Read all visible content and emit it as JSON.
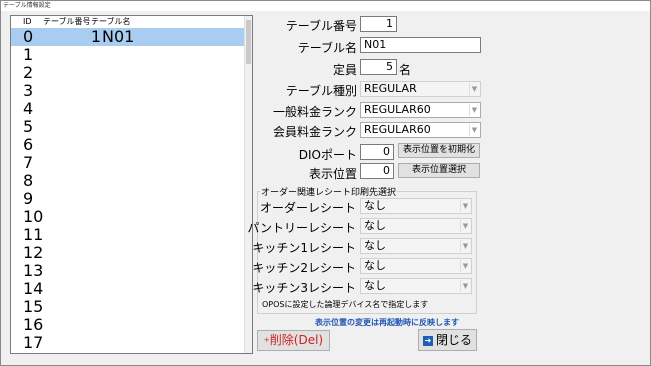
{
  "window": {
    "title": "テーブル情報設定"
  },
  "list": {
    "headers": {
      "id": "ID",
      "number": "テーブル番号",
      "name": "テーブル名"
    },
    "rows": [
      {
        "id": "0",
        "number": "1",
        "name": "N01"
      },
      {
        "id": "1",
        "number": "",
        "name": ""
      },
      {
        "id": "2",
        "number": "",
        "name": ""
      },
      {
        "id": "3",
        "number": "",
        "name": ""
      },
      {
        "id": "4",
        "number": "",
        "name": ""
      },
      {
        "id": "5",
        "number": "",
        "name": ""
      },
      {
        "id": "6",
        "number": "",
        "name": ""
      },
      {
        "id": "7",
        "number": "",
        "name": ""
      },
      {
        "id": "8",
        "number": "",
        "name": ""
      },
      {
        "id": "9",
        "number": "",
        "name": ""
      },
      {
        "id": "10",
        "number": "",
        "name": ""
      },
      {
        "id": "11",
        "number": "",
        "name": ""
      },
      {
        "id": "12",
        "number": "",
        "name": ""
      },
      {
        "id": "13",
        "number": "",
        "name": ""
      },
      {
        "id": "14",
        "number": "",
        "name": ""
      },
      {
        "id": "15",
        "number": "",
        "name": ""
      },
      {
        "id": "16",
        "number": "",
        "name": ""
      },
      {
        "id": "17",
        "number": "",
        "name": ""
      }
    ]
  },
  "form": {
    "table_number": {
      "label": "テーブル番号",
      "value": "1"
    },
    "table_name": {
      "label": "テーブル名",
      "value": "N01"
    },
    "capacity": {
      "label": "定員",
      "value": "5",
      "unit": "名"
    },
    "table_type": {
      "label": "テーブル種別",
      "value": "REGULAR"
    },
    "general_rank": {
      "label": "一般料金ランク",
      "value": "REGULAR60"
    },
    "member_rank": {
      "label": "会員料金ランク",
      "value": "REGULAR60"
    },
    "dio_port": {
      "label": "DIOポート",
      "value": "0",
      "button": "表示位置を初期化"
    },
    "display_position": {
      "label": "表示位置",
      "value": "0",
      "button": "表示位置選択"
    }
  },
  "receipt_group": {
    "title": "オーダー関連レシート印刷先選択",
    "items": [
      {
        "label": "オーダーレシート",
        "value": "なし"
      },
      {
        "label": "パントリーレシート",
        "value": "なし"
      },
      {
        "label": "キッチン1レシート",
        "value": "なし"
      },
      {
        "label": "キッチン2レシート",
        "value": "なし"
      },
      {
        "label": "キッチン3レシート",
        "value": "なし"
      }
    ],
    "note": "OPOSに設定した論理デバイス名で指定します"
  },
  "notice": "表示位置の変更は再起動時に反映します",
  "buttons": {
    "delete": "削除(Del)",
    "close": "閉じる"
  },
  "colors": {
    "selection": "#a8cdf0",
    "notice": "#1f56b4",
    "delete": "#d02020",
    "close_icon": "#1f5fb4"
  }
}
